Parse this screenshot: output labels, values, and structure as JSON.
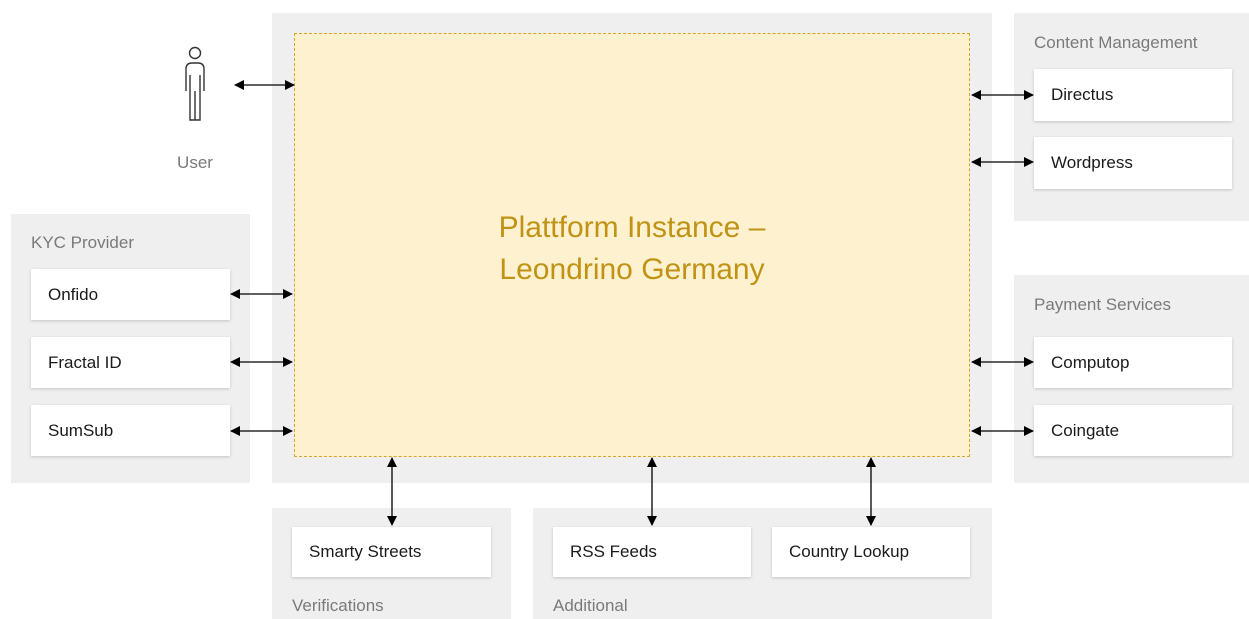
{
  "platform": {
    "title_line1": "Plattform Instance –",
    "title_line2": "Leondrino Germany"
  },
  "user": {
    "label": "User",
    "icon": "person-icon"
  },
  "groups": {
    "content_management": {
      "label": "Content Management",
      "items": [
        "Directus",
        "Wordpress"
      ]
    },
    "kyc_provider": {
      "label": "KYC Provider",
      "items": [
        "Onfido",
        "Fractal ID",
        "SumSub"
      ]
    },
    "payment_services": {
      "label": "Payment Services",
      "items": [
        "Computop",
        "Coingate"
      ]
    },
    "verifications": {
      "label": "Verifications",
      "items": [
        "Smarty Streets"
      ]
    },
    "additional": {
      "label": "Additional",
      "items": [
        "RSS Feeds",
        "Country Lookup"
      ]
    }
  },
  "colors": {
    "platform_fill": "#fdf1cf",
    "platform_border": "#d4a52a",
    "platform_text": "#c09314",
    "panel": "#efefef"
  }
}
